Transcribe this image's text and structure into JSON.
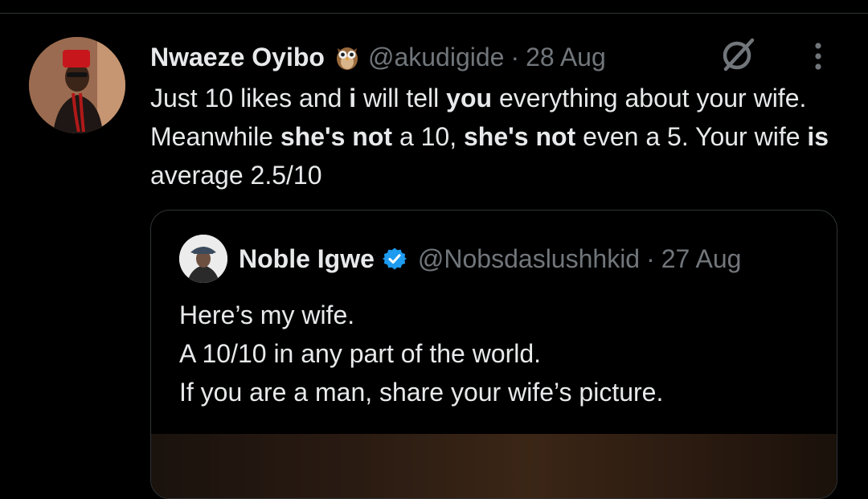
{
  "tweet": {
    "author": {
      "display_name": "Nwaeze Oyibo",
      "emoji_icon": "owl-icon",
      "handle": "@akudigide",
      "separator": "·",
      "date": "28 Aug"
    },
    "text_segments": [
      {
        "text": "Just 10 likes and ",
        "bold": false
      },
      {
        "text": "i",
        "bold": true
      },
      {
        "text": " will tell ",
        "bold": false
      },
      {
        "text": "you",
        "bold": true
      },
      {
        "text": " everything about your wife. Meanwhile ",
        "bold": false
      },
      {
        "text": "she's not",
        "bold": true
      },
      {
        "text": " a 10, ",
        "bold": false
      },
      {
        "text": "she's not",
        "bold": true
      },
      {
        "text": " even a 5. Your wife ",
        "bold": false
      },
      {
        "text": "is",
        "bold": true
      },
      {
        "text": " average 2.5/10",
        "bold": false
      }
    ],
    "actions": {
      "grok_icon": "grok-icon",
      "more_icon": "more-vertical-icon"
    }
  },
  "quote": {
    "author": {
      "display_name": "Noble Igwe",
      "verified_icon": "verified-badge-icon",
      "handle": "@Nobsdaslushhkid",
      "separator": "·",
      "date": "27 Aug"
    },
    "lines": [
      "Here’s my wife.",
      "A 10/10 in any part of the world.",
      "If you are a man, share your wife’s picture."
    ]
  },
  "colors": {
    "background": "#000000",
    "text_primary": "#e7e9ea",
    "text_secondary": "#71767b",
    "border": "#2f3336",
    "verified_blue": "#1d9bf0"
  }
}
